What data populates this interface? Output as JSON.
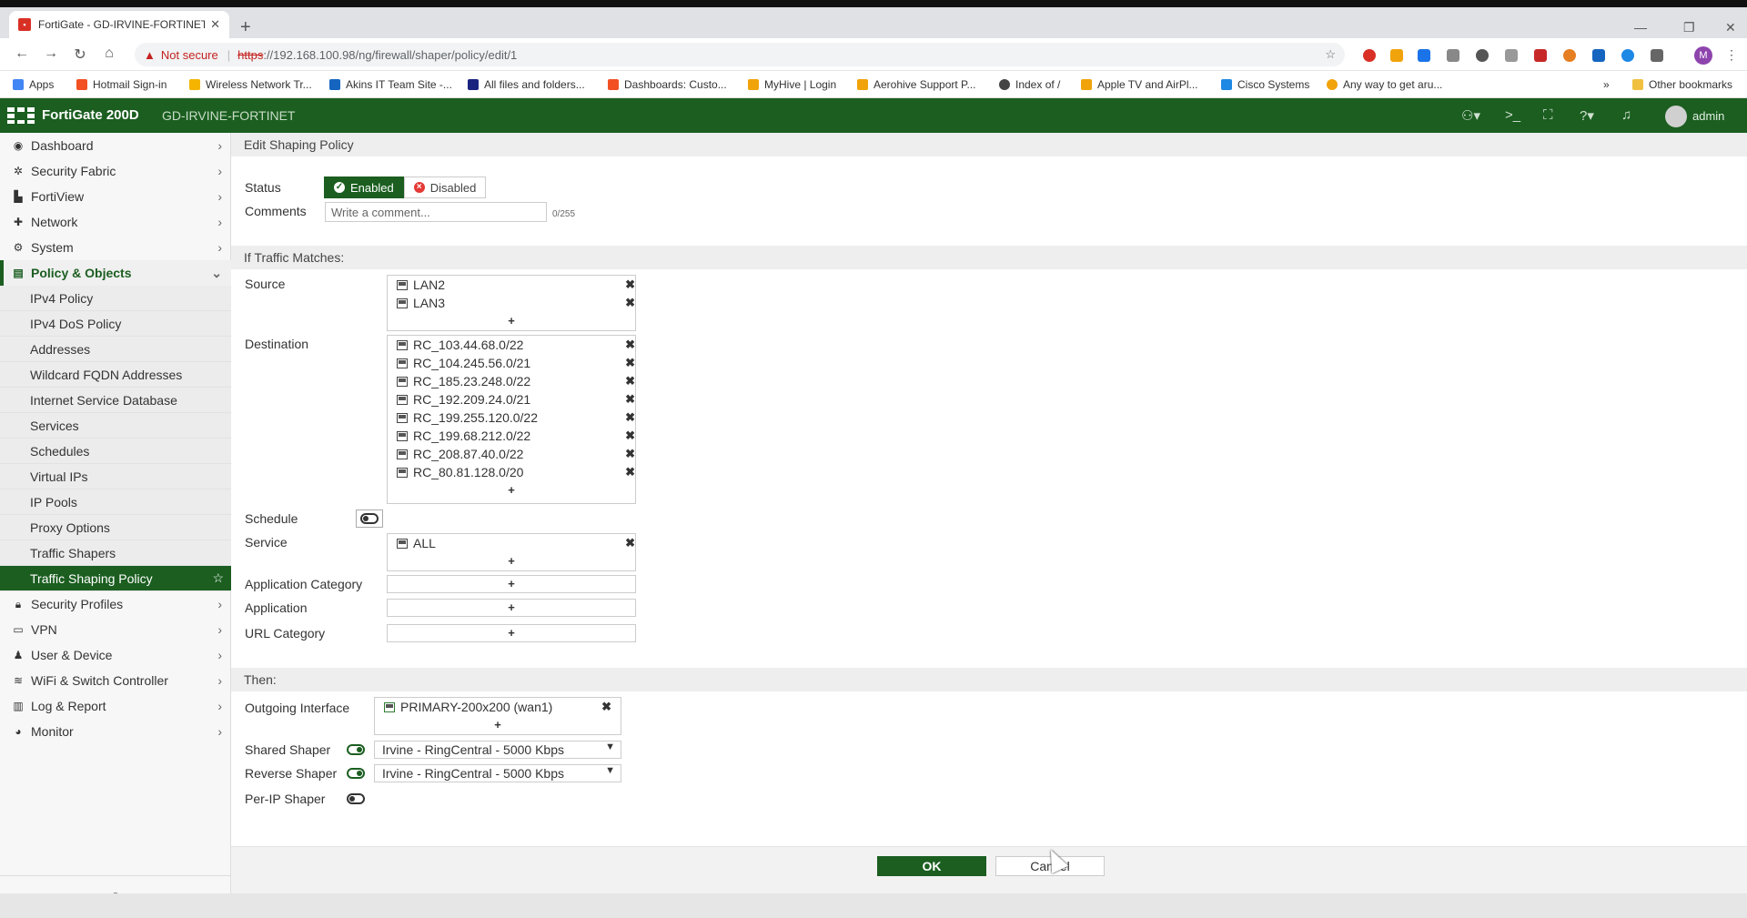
{
  "browser": {
    "tab_title": "FortiGate - GD-IRVINE-FORTINET",
    "new_tab": "+",
    "not_secure": "Not secure",
    "url_scheme": "https",
    "url_rest": "://192.168.100.98/ng/firewall/shaper/policy/edit/1",
    "profile_initial": "M",
    "bookmarks": [
      "Apps",
      "Hotmail Sign-in",
      "Wireless Network Tr...",
      "Akins IT Team Site -...",
      "All files and folders...",
      "Dashboards: Custo...",
      "MyHive | Login",
      "Aerohive Support P...",
      "Index of /",
      "Apple TV and AirPl...",
      "Cisco Systems",
      "Any way to get aru..."
    ],
    "bookmarks_more": "»",
    "other_bookmarks": "Other bookmarks"
  },
  "header": {
    "product": "FortiGate 200D",
    "hostname": "GD-IRVINE-FORTINET",
    "user": "admin"
  },
  "sidebar": {
    "items": [
      {
        "label": "Dashboard",
        "icon": "dashboard-icon"
      },
      {
        "label": "Security Fabric",
        "icon": "fabric-icon"
      },
      {
        "label": "FortiView",
        "icon": "chart-icon"
      },
      {
        "label": "Network",
        "icon": "network-icon"
      },
      {
        "label": "System",
        "icon": "gear-icon"
      },
      {
        "label": "Policy & Objects",
        "icon": "policy-icon"
      }
    ],
    "subitems": [
      "IPv4 Policy",
      "IPv4 DoS Policy",
      "Addresses",
      "Wildcard FQDN Addresses",
      "Internet Service Database",
      "Services",
      "Schedules",
      "Virtual IPs",
      "IP Pools",
      "Proxy Options",
      "Traffic Shapers",
      "Traffic Shaping Policy"
    ],
    "after_items": [
      {
        "label": "Security Profiles",
        "icon": "lock-icon"
      },
      {
        "label": "VPN",
        "icon": "vpn-icon"
      },
      {
        "label": "User & Device",
        "icon": "user-icon"
      },
      {
        "label": "WiFi & Switch Controller",
        "icon": "wifi-icon"
      },
      {
        "label": "Log & Report",
        "icon": "report-icon"
      },
      {
        "label": "Monitor",
        "icon": "monitor-icon"
      }
    ]
  },
  "form": {
    "title": "Edit Shaping Policy",
    "status_label": "Status",
    "enabled": "Enabled",
    "disabled": "Disabled",
    "comments_label": "Comments",
    "comments_placeholder": "Write a comment...",
    "comments_counter": "0/255",
    "match_title": "If Traffic Matches:",
    "source_label": "Source",
    "source": [
      "LAN2",
      "LAN3"
    ],
    "destination_label": "Destination",
    "destination": [
      "RC_103.44.68.0/22",
      "RC_104.245.56.0/21",
      "RC_185.23.248.0/22",
      "RC_192.209.24.0/21",
      "RC_199.255.120.0/22",
      "RC_199.68.212.0/22",
      "RC_208.87.40.0/22",
      "RC_80.81.128.0/20"
    ],
    "schedule_label": "Schedule",
    "service_label": "Service",
    "service": [
      "ALL"
    ],
    "app_category_label": "Application Category",
    "application_label": "Application",
    "url_category_label": "URL Category",
    "plus": "+",
    "then_title": "Then:",
    "outgoing_label": "Outgoing Interface",
    "outgoing": [
      "PRIMARY-200x200 (wan1)"
    ],
    "shared_shaper_label": "Shared Shaper",
    "shared_shaper_value": "Irvine - RingCentral - 5000 Kbps",
    "reverse_shaper_label": "Reverse Shaper",
    "reverse_shaper_value": "Irvine - RingCentral - 5000 Kbps",
    "per_ip_label": "Per-IP Shaper",
    "ok": "OK",
    "cancel": "Cancel"
  },
  "colors": {
    "brand_green": "#1b5e20",
    "disabled_red": "#e53935"
  }
}
